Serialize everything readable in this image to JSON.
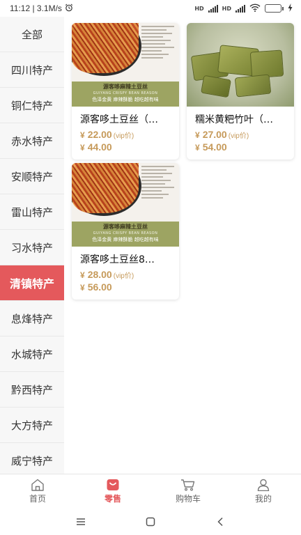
{
  "status_bar": {
    "left_text": "11:12 | 3.1M/s",
    "alarm_icon": "alarm-clock-icon",
    "net1": "HD",
    "net2": "HD",
    "battery": "76",
    "battery_level": 0.76
  },
  "sidebar": {
    "items": [
      {
        "label": "全部"
      },
      {
        "label": "四川特产"
      },
      {
        "label": "铜仁特产"
      },
      {
        "label": "赤水特产"
      },
      {
        "label": "安顺特产"
      },
      {
        "label": "雷山特产"
      },
      {
        "label": "习水特产"
      },
      {
        "label": "清镇特产"
      },
      {
        "label": "息烽特产"
      },
      {
        "label": "水城特产"
      },
      {
        "label": "黔西特产"
      },
      {
        "label": "大方特产"
      },
      {
        "label": "威宁特产"
      }
    ],
    "active_label": "清镇特产"
  },
  "products": [
    {
      "name": "源客哆土豆丝（…",
      "vip_price": "22.00",
      "vip_tag": "(vip价)",
      "price": "44.00",
      "banner_title": "源客哆麻辣土豆丝",
      "banner_sub": "GUIYANG CRISPY BEAN REASON",
      "banner_slogan": "色泽金黄  麻辣酥脆  越吃越有味"
    },
    {
      "name": "糯米黄粑竹叶（…",
      "vip_price": "27.00",
      "vip_tag": "(vip价)",
      "price": "54.00"
    },
    {
      "name": "源客哆土豆丝8…",
      "vip_price": "28.00",
      "vip_tag": "(vip价)",
      "price": "56.00",
      "banner_title": "源客哆麻辣土豆丝",
      "banner_sub": "GUIYANG CRISPY BEAN REASON",
      "banner_slogan": "色泽金黄  麻辣酥脆  越吃越有味"
    }
  ],
  "currency": "¥",
  "bottom_nav": [
    {
      "label": "首页",
      "icon": "home-icon"
    },
    {
      "label": "零售",
      "icon": "shopping-bag-icon"
    },
    {
      "label": "购物车",
      "icon": "cart-icon"
    },
    {
      "label": "我的",
      "icon": "user-icon"
    }
  ],
  "colors": {
    "accent": "#e4595c",
    "price": "#c69a5a"
  }
}
